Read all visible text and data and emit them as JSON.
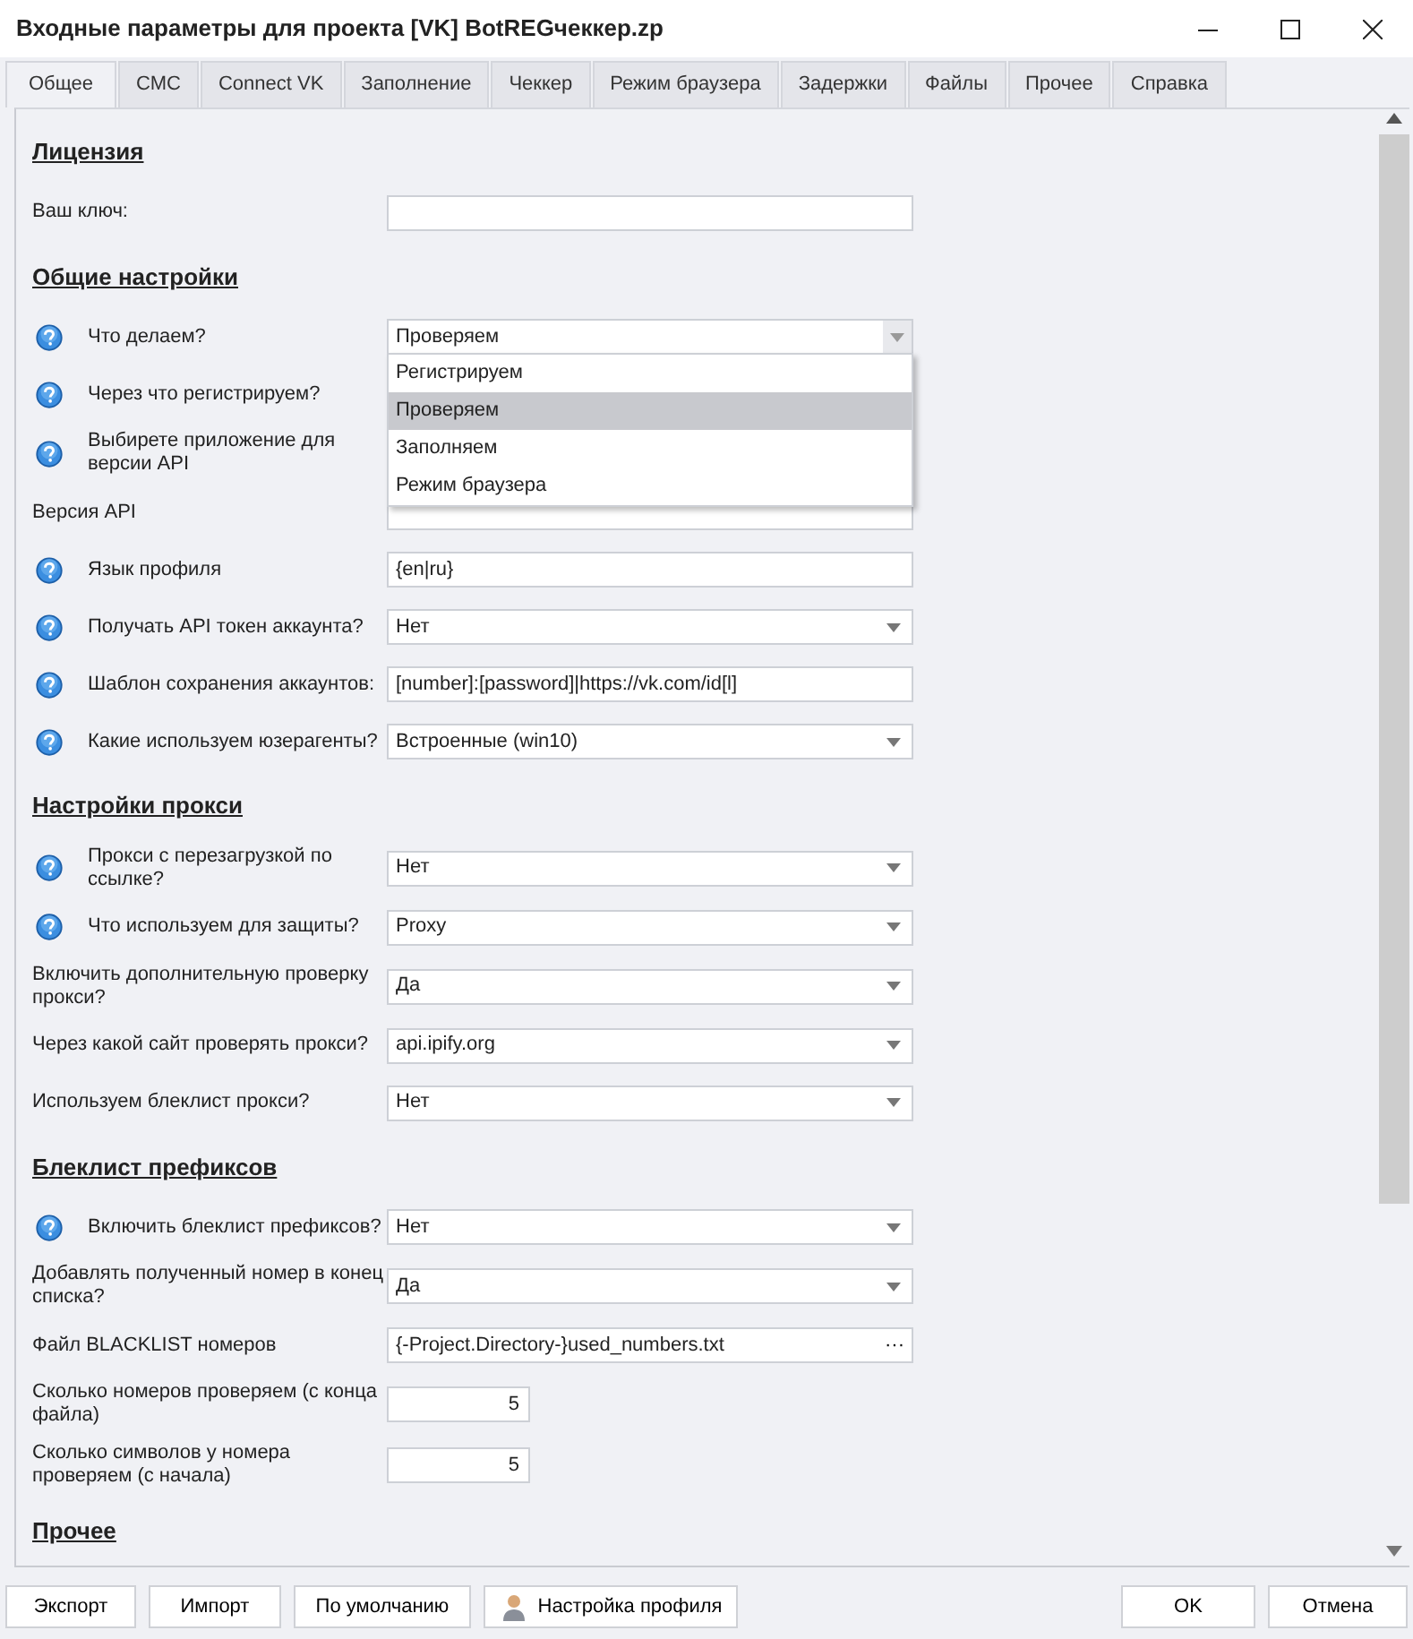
{
  "window": {
    "title": "Входные параметры для проекта [VK] BotREGчеккер.zp"
  },
  "tabs": [
    {
      "label": "Общее",
      "selected": true
    },
    {
      "label": "СМС",
      "selected": false
    },
    {
      "label": "Connect VK",
      "selected": false
    },
    {
      "label": "Заполнение",
      "selected": false
    },
    {
      "label": "Чеккер",
      "selected": false
    },
    {
      "label": "Режим браузера",
      "selected": false
    },
    {
      "label": "Задержки",
      "selected": false
    },
    {
      "label": "Файлы",
      "selected": false
    },
    {
      "label": "Прочее",
      "selected": false
    },
    {
      "label": "Справка",
      "selected": false
    }
  ],
  "sections": [
    {
      "title": "Лицензия",
      "rows": [
        {
          "label": "Ваш ключ:",
          "help": false,
          "kind": "text"
        }
      ]
    },
    {
      "title": "Общие настройки",
      "rows": [
        {
          "label": "Что делаем?",
          "help": true,
          "kind": "select",
          "value": "Проверяем",
          "open": true,
          "options": [
            {
              "label": "Регистрируем",
              "selected": false
            },
            {
              "label": "Проверяем",
              "selected": true
            },
            {
              "label": "Заполняем",
              "selected": false
            },
            {
              "label": "Режим браузера",
              "selected": false
            }
          ]
        },
        {
          "label": "Через что регистрируем?",
          "help": true,
          "kind": "hidden"
        },
        {
          "label": "Выбирете приложение для версии API",
          "help": true,
          "kind": "hidden"
        },
        {
          "label": "Версия API",
          "help": false,
          "kind": "text"
        },
        {
          "label": "Язык профиля",
          "help": true,
          "kind": "text",
          "value": "{en|ru}"
        },
        {
          "label": "Получать API токен аккаунта?",
          "help": true,
          "kind": "select",
          "value": "Нет"
        },
        {
          "label": "Шаблон сохранения аккаунтов:",
          "help": true,
          "kind": "text",
          "value": "[number]:[password]|https://vk.com/id[l]"
        },
        {
          "label": "Какие используем юзерагенты?",
          "help": true,
          "kind": "select",
          "value": "Встроенные (win10)"
        }
      ]
    },
    {
      "title": "Настройки прокси",
      "rows": [
        {
          "label": "Прокси с перезагрузкой по ссылке?",
          "help": true,
          "kind": "select",
          "value": "Нет"
        },
        {
          "label": "Что используем для защиты?",
          "help": true,
          "kind": "select",
          "value": "Proxy"
        },
        {
          "label": "Включить дополнительную проверку прокси?",
          "help": false,
          "kind": "select",
          "value": "Да"
        },
        {
          "label": "Через какой сайт проверять прокси?",
          "help": false,
          "kind": "select",
          "value": "api.ipify.org"
        },
        {
          "label": "Используем блеклист прокси?",
          "help": false,
          "kind": "select",
          "value": "Нет"
        }
      ]
    },
    {
      "title": "Блеклист префиксов",
      "rows": [
        {
          "label": "Включить блеклист префиксов?",
          "help": true,
          "kind": "select",
          "value": "Нет"
        },
        {
          "label": "Добавлять полученный номер в конец списка?",
          "help": false,
          "kind": "select",
          "value": "Да"
        },
        {
          "label": "Файл BLACKLIST номеров",
          "help": false,
          "kind": "file",
          "value": "{-Project.Directory-}used_numbers.txt",
          "button": "···"
        },
        {
          "label": "Сколько номеров проверяем (с конца файла)",
          "help": false,
          "kind": "number",
          "value": "5"
        },
        {
          "label": "Сколько символов у номера проверяем (с начала)",
          "help": false,
          "kind": "number",
          "value": "5"
        }
      ]
    },
    {
      "title": "Прочее"
    }
  ],
  "buttons_left": [
    {
      "label": "Экспорт",
      "icon": false
    },
    {
      "label": "Импорт",
      "icon": false
    },
    {
      "label": "По умолчанию",
      "icon": false
    },
    {
      "label": "Настройка профиля",
      "icon": true
    }
  ],
  "buttons_right": [
    {
      "label": "OK"
    },
    {
      "label": "Отмена"
    }
  ]
}
